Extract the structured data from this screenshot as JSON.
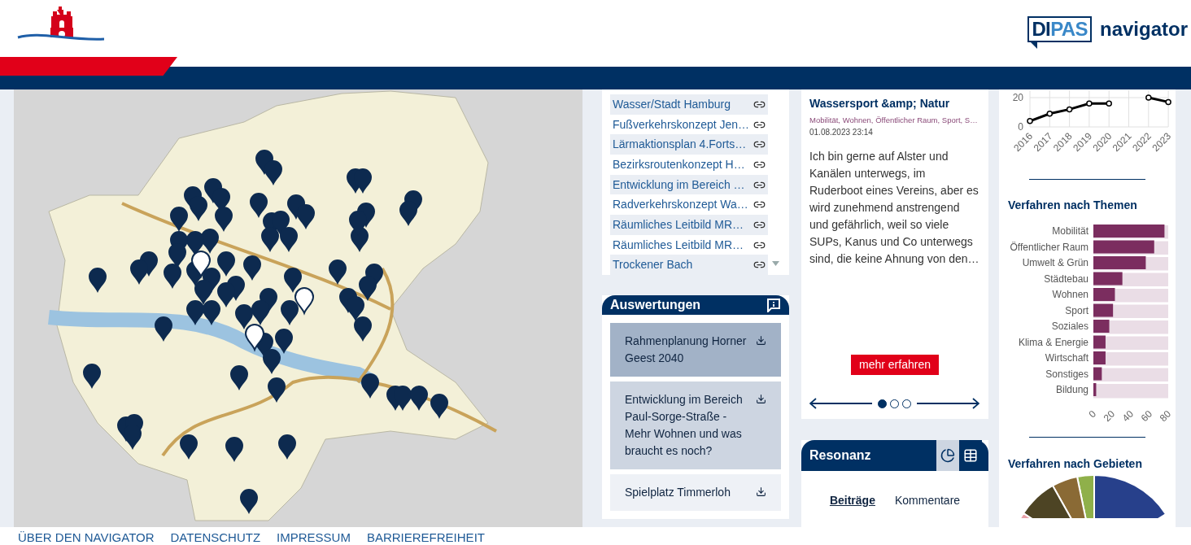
{
  "header": {
    "brand_parts": [
      "DI",
      "PAS"
    ],
    "brand_suffix": "navigator"
  },
  "procedures_list": {
    "items": [
      {
        "label": "Wasser/Stadt Hamburg"
      },
      {
        "label": "Fußverkehrskonzept Jen…"
      },
      {
        "label": "Lärmaktionsplan 4.Forts…"
      },
      {
        "label": "Bezirksroutenkonzept H…"
      },
      {
        "label": "Entwicklung im Bereich …"
      },
      {
        "label": "Radverkehrskonzept Wa…"
      },
      {
        "label": "Räumliches Leitbild MR…"
      },
      {
        "label": "Räumliches Leitbild MR…"
      },
      {
        "label": "Trockener Bach"
      }
    ]
  },
  "evaluations": {
    "title": "Auswertungen",
    "items": [
      {
        "label": "Rahmenplanung Horner Geest 2040",
        "selected": true
      },
      {
        "label": "Entwicklung im Bereich Paul-Sorge-Straße - Mehr Wohnen und was braucht es noch?",
        "selected": false
      },
      {
        "label": "Spielplatz Timmerloh",
        "selected": false
      }
    ]
  },
  "contribution": {
    "title": "Wassersport &amp; Natur",
    "tags": "Mobilität, Wohnen, Öffentlicher Raum, Sport, S…",
    "date": "01.08.2023 23:14",
    "text": "Ich bin gerne auf Alster und Kanälen unterwegs, im Ruderboot eines Vereins, aber es wird zunehmend anstrengend und gefährlich, weil so viele SUPs, Kanus und Co unterwegs sind, die keine Ahnung von den…",
    "button": "mehr erfahren",
    "dots": [
      {
        "selected": true
      },
      {
        "selected": false
      },
      {
        "selected": false
      }
    ]
  },
  "resonance": {
    "title": "Resonanz",
    "views": [
      {
        "kind": "chart",
        "selected": true
      },
      {
        "kind": "table",
        "selected": false
      }
    ],
    "tabs": [
      {
        "label": "Beiträge",
        "selected": true
      },
      {
        "label": "Kommentare",
        "selected": false
      }
    ]
  },
  "statistics": {
    "line_chart": {
      "chart_data": {
        "type": "line",
        "categories": [
          "2016",
          "2017",
          "2018",
          "2019",
          "2020",
          "2021",
          "2022",
          "2023"
        ],
        "series": [
          {
            "color": "#000000",
            "marker": "circle",
            "values": [
              4,
              9,
              12,
              16,
              16,
              null,
              20,
              17
            ]
          }
        ],
        "ylim": [
          0,
          25
        ],
        "yticks": [
          0,
          20
        ]
      }
    },
    "themes": {
      "title": "Verfahren nach Themen",
      "chart_data": {
        "type": "bar",
        "orientation": "horizontal",
        "categories": [
          "Mobilität",
          "Öffentlicher Raum",
          "Umwelt & Grün",
          "Städtebau",
          "Wohnen",
          "Sport",
          "Soziales",
          "Klima & Energie",
          "Wirtschaft",
          "Sonstiges",
          "Bildung"
        ],
        "series": [
          {
            "color": "#7b2d5f",
            "values": [
              76,
              65,
              56,
              31,
              23,
              21,
              17,
              13,
              13,
              9,
              3
            ]
          }
        ],
        "xlim": [
          0,
          80
        ],
        "xticks": [
          0,
          20,
          40,
          60,
          80
        ]
      }
    },
    "areas": {
      "title": "Verfahren nach Gebieten"
    }
  },
  "footer": {
    "links": [
      "ÜBER DEN NAVIGATOR",
      "DATENSCHUTZ",
      "IMPRESSUM",
      "BARRIEREFREIHEIT"
    ]
  }
}
